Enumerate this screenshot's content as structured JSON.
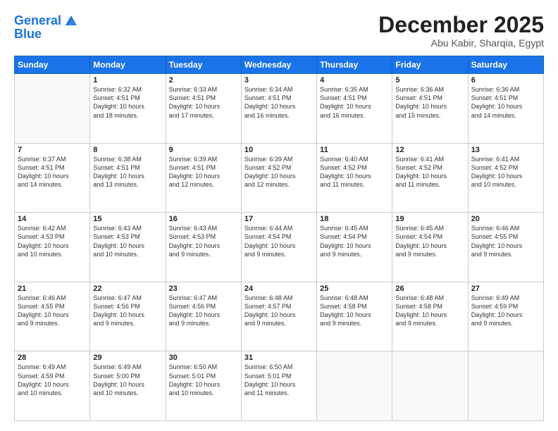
{
  "header": {
    "logo_line1": "General",
    "logo_line2": "Blue",
    "month": "December 2025",
    "location": "Abu Kabir, Sharqia, Egypt"
  },
  "weekdays": [
    "Sunday",
    "Monday",
    "Tuesday",
    "Wednesday",
    "Thursday",
    "Friday",
    "Saturday"
  ],
  "weeks": [
    [
      {
        "day": "",
        "info": ""
      },
      {
        "day": "1",
        "info": "Sunrise: 6:32 AM\nSunset: 4:51 PM\nDaylight: 10 hours\nand 18 minutes."
      },
      {
        "day": "2",
        "info": "Sunrise: 6:33 AM\nSunset: 4:51 PM\nDaylight: 10 hours\nand 17 minutes."
      },
      {
        "day": "3",
        "info": "Sunrise: 6:34 AM\nSunset: 4:51 PM\nDaylight: 10 hours\nand 16 minutes."
      },
      {
        "day": "4",
        "info": "Sunrise: 6:35 AM\nSunset: 4:51 PM\nDaylight: 10 hours\nand 16 minutes."
      },
      {
        "day": "5",
        "info": "Sunrise: 6:36 AM\nSunset: 4:51 PM\nDaylight: 10 hours\nand 15 minutes."
      },
      {
        "day": "6",
        "info": "Sunrise: 6:36 AM\nSunset: 4:51 PM\nDaylight: 10 hours\nand 14 minutes."
      }
    ],
    [
      {
        "day": "7",
        "info": "Sunrise: 6:37 AM\nSunset: 4:51 PM\nDaylight: 10 hours\nand 14 minutes."
      },
      {
        "day": "8",
        "info": "Sunrise: 6:38 AM\nSunset: 4:51 PM\nDaylight: 10 hours\nand 13 minutes."
      },
      {
        "day": "9",
        "info": "Sunrise: 6:39 AM\nSunset: 4:51 PM\nDaylight: 10 hours\nand 12 minutes."
      },
      {
        "day": "10",
        "info": "Sunrise: 6:39 AM\nSunset: 4:52 PM\nDaylight: 10 hours\nand 12 minutes."
      },
      {
        "day": "11",
        "info": "Sunrise: 6:40 AM\nSunset: 4:52 PM\nDaylight: 10 hours\nand 11 minutes."
      },
      {
        "day": "12",
        "info": "Sunrise: 6:41 AM\nSunset: 4:52 PM\nDaylight: 10 hours\nand 11 minutes."
      },
      {
        "day": "13",
        "info": "Sunrise: 6:41 AM\nSunset: 4:52 PM\nDaylight: 10 hours\nand 10 minutes."
      }
    ],
    [
      {
        "day": "14",
        "info": "Sunrise: 6:42 AM\nSunset: 4:53 PM\nDaylight: 10 hours\nand 10 minutes."
      },
      {
        "day": "15",
        "info": "Sunrise: 6:43 AM\nSunset: 4:53 PM\nDaylight: 10 hours\nand 10 minutes."
      },
      {
        "day": "16",
        "info": "Sunrise: 6:43 AM\nSunset: 4:53 PM\nDaylight: 10 hours\nand 9 minutes."
      },
      {
        "day": "17",
        "info": "Sunrise: 6:44 AM\nSunset: 4:54 PM\nDaylight: 10 hours\nand 9 minutes."
      },
      {
        "day": "18",
        "info": "Sunrise: 6:45 AM\nSunset: 4:54 PM\nDaylight: 10 hours\nand 9 minutes."
      },
      {
        "day": "19",
        "info": "Sunrise: 6:45 AM\nSunset: 4:54 PM\nDaylight: 10 hours\nand 9 minutes."
      },
      {
        "day": "20",
        "info": "Sunrise: 6:46 AM\nSunset: 4:55 PM\nDaylight: 10 hours\nand 9 minutes."
      }
    ],
    [
      {
        "day": "21",
        "info": "Sunrise: 6:46 AM\nSunset: 4:55 PM\nDaylight: 10 hours\nand 9 minutes."
      },
      {
        "day": "22",
        "info": "Sunrise: 6:47 AM\nSunset: 4:56 PM\nDaylight: 10 hours\nand 9 minutes."
      },
      {
        "day": "23",
        "info": "Sunrise: 6:47 AM\nSunset: 4:56 PM\nDaylight: 10 hours\nand 9 minutes."
      },
      {
        "day": "24",
        "info": "Sunrise: 6:48 AM\nSunset: 4:57 PM\nDaylight: 10 hours\nand 9 minutes."
      },
      {
        "day": "25",
        "info": "Sunrise: 6:48 AM\nSunset: 4:58 PM\nDaylight: 10 hours\nand 9 minutes."
      },
      {
        "day": "26",
        "info": "Sunrise: 6:48 AM\nSunset: 4:58 PM\nDaylight: 10 hours\nand 9 minutes."
      },
      {
        "day": "27",
        "info": "Sunrise: 6:49 AM\nSunset: 4:59 PM\nDaylight: 10 hours\nand 9 minutes."
      }
    ],
    [
      {
        "day": "28",
        "info": "Sunrise: 6:49 AM\nSunset: 4:59 PM\nDaylight: 10 hours\nand 10 minutes."
      },
      {
        "day": "29",
        "info": "Sunrise: 6:49 AM\nSunset: 5:00 PM\nDaylight: 10 hours\nand 10 minutes."
      },
      {
        "day": "30",
        "info": "Sunrise: 6:50 AM\nSunset: 5:01 PM\nDaylight: 10 hours\nand 10 minutes."
      },
      {
        "day": "31",
        "info": "Sunrise: 6:50 AM\nSunset: 5:01 PM\nDaylight: 10 hours\nand 11 minutes."
      },
      {
        "day": "",
        "info": ""
      },
      {
        "day": "",
        "info": ""
      },
      {
        "day": "",
        "info": ""
      }
    ]
  ]
}
